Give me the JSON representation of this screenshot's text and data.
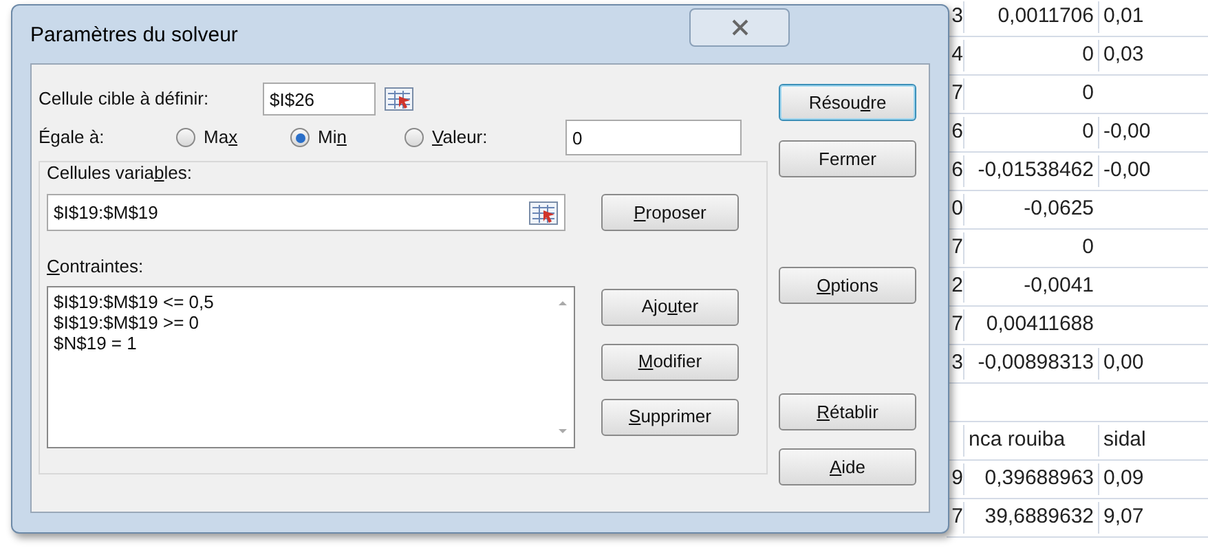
{
  "sheet": {
    "rows": [
      {
        "c1": "3",
        "c2": "0,0011706",
        "c3": "0,01"
      },
      {
        "c1": "4",
        "c2": "0",
        "c3": "0,03"
      },
      {
        "c1": "7",
        "c2": "0"
      },
      {
        "c1": "6",
        "c2": "0",
        "c3": "-0,00"
      },
      {
        "c1": "6",
        "c2": "-0,01538462",
        "c3": "-0,00"
      },
      {
        "c1": "0",
        "c2": "-0,0625"
      },
      {
        "c1": "7",
        "c2": "0"
      },
      {
        "c1": "2",
        "c2": "-0,0041"
      },
      {
        "c1": "7",
        "c2": "0,00411688"
      },
      {
        "c1": "3",
        "c2": "-0,00898313",
        "c3": "0,00"
      },
      {
        "kind": "blank"
      },
      {
        "c2": "nca rouiba",
        "c3": "sidal",
        "kind": "header"
      },
      {
        "c1": "9",
        "c2": "0,39688963",
        "c3": "0,09"
      },
      {
        "c1": "7",
        "c2": "39,6889632",
        "c3": "9,07"
      }
    ]
  },
  "dialog": {
    "title": "Paramètres du solveur",
    "target": {
      "label": "Cellule cible à définir:",
      "value": "$I$26"
    },
    "equal": {
      "label": "Égale à:",
      "options": [
        {
          "parts": {
            "before": "Ma",
            "key": "x"
          },
          "selected": false
        },
        {
          "parts": {
            "before": "Mi",
            "key": "n"
          },
          "selected": true
        },
        {
          "parts": {
            "key": "V",
            "after": "aleur:"
          },
          "selected": false
        }
      ],
      "value": "0"
    },
    "variables": {
      "parts": {
        "before": "Cellules varia",
        "key": "b",
        "after": "les:"
      },
      "value": "$I$19:$M$19",
      "button": {
        "key": "P",
        "after": "roposer"
      }
    },
    "constraints": {
      "parts": {
        "key": "C",
        "after": "ontraintes:"
      },
      "items": [
        "$I$19:$M$19 <= 0,5",
        "$I$19:$M$19 >= 0",
        "$N$19 = 1"
      ],
      "buttons": [
        {
          "before": "Ajo",
          "key": "u",
          "after": "ter"
        },
        {
          "key": "M",
          "after": "odifier"
        },
        {
          "key": "S",
          "after": "upprimer"
        }
      ]
    },
    "side_buttons": [
      {
        "parts": {
          "before": "Résou",
          "key": "d",
          "after": "re"
        },
        "default": true
      },
      {
        "parts": {
          "before": "Fermer"
        },
        "default": false
      },
      {
        "parts": {
          "key": "O",
          "after": "ptions"
        },
        "default": false
      },
      {
        "parts": {
          "key": "R",
          "after": "établir"
        },
        "default": false
      },
      {
        "parts": {
          "key": "A",
          "after": "ide"
        },
        "default": false
      }
    ]
  }
}
